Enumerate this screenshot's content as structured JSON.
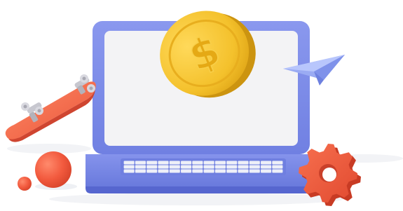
{
  "illustration": {
    "subject": "laptop-with-coin-paper-plane-skateboard-gear",
    "coin_symbol": "$",
    "keyboard_key_rows": 3,
    "keyboard_keys_per_row": 14,
    "colors": {
      "laptop_frame": "#7f8ee8",
      "laptop_frame_dark": "#6474d6",
      "screen": "#f3f3f5",
      "keyboard_keys": "#eef0f8",
      "coin_face": "#f4c430",
      "coin_edge": "#d9a11a",
      "coin_symbol": "#e6a817",
      "paper_plane": "#8ea2f0",
      "paper_plane_light": "#b7c5fb",
      "skateboard_deck": "#ef6a48",
      "skateboard_truck": "#c9c9d1",
      "sphere": "#f05a3f",
      "gear": "#ef5b3d",
      "shadow": "#eceef2"
    }
  }
}
